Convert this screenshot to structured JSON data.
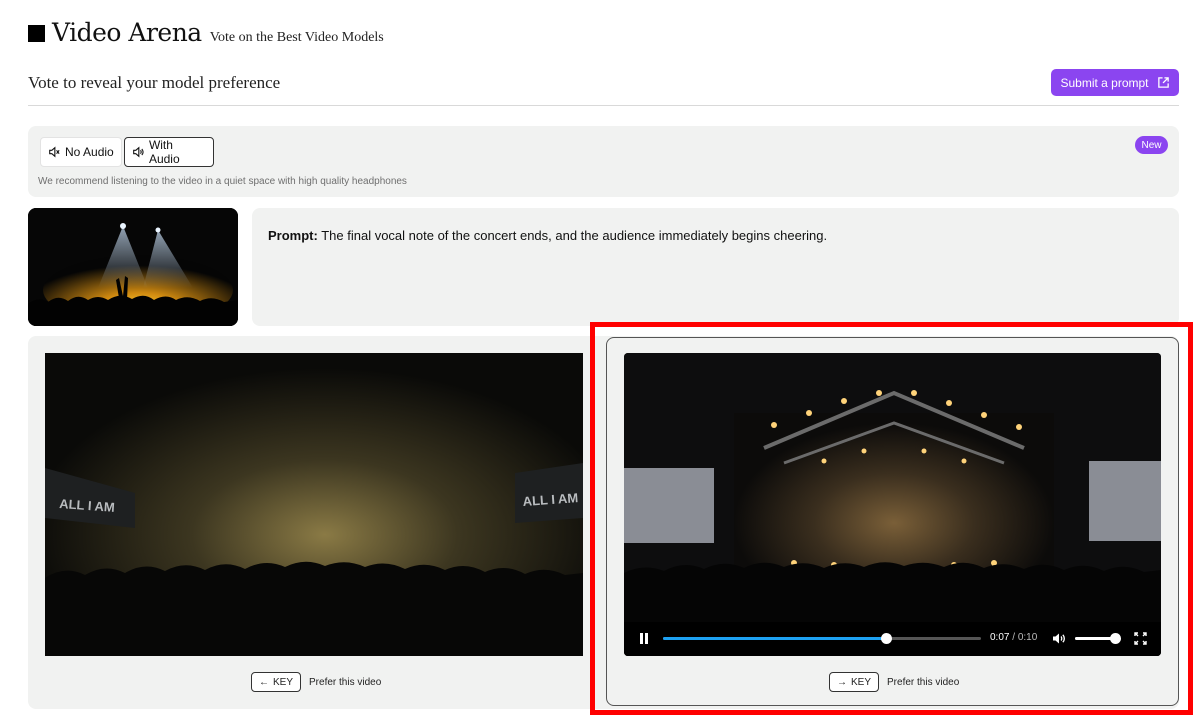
{
  "header": {
    "title": "Video Arena",
    "subtitle": "Vote on the Best Video Models"
  },
  "page": {
    "heading": "Vote to reveal your model preference",
    "submit_label": "Submit a prompt"
  },
  "audio": {
    "no_audio_label": "No Audio",
    "with_audio_label": "With Audio",
    "selected": "With Audio",
    "badge": "New",
    "recommendation": "We recommend listening to the video in a quiet space with high quality headphones"
  },
  "prompt": {
    "label": "Prompt:",
    "text": "The final vocal note of the concert ends, and the audience immediately begins cheering."
  },
  "videos": {
    "left": {
      "key_label": "KEY",
      "key_arrow": "←",
      "prefer_label": "Prefer this video",
      "screen_text": "ALL I AM"
    },
    "right": {
      "key_label": "KEY",
      "key_arrow": "→",
      "prefer_label": "Prefer this video",
      "current_time": "0:07",
      "separator": " / ",
      "duration": "0:10",
      "progress": 0.7,
      "volume": 0.9
    }
  },
  "colors": {
    "accent": "#8b45f0",
    "progress": "#1da1f2",
    "highlight": "#ff0000"
  }
}
